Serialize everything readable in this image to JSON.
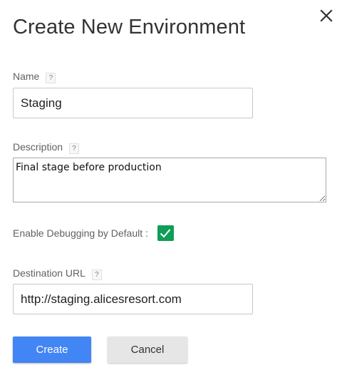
{
  "dialog": {
    "title": "Create New Environment"
  },
  "help_symbol": "?",
  "fields": {
    "name": {
      "label": "Name",
      "value": "Staging"
    },
    "description": {
      "label": "Description",
      "value": "Final stage before production"
    },
    "debugging": {
      "label": "Enable Debugging by Default :",
      "checked": true
    },
    "destination_url": {
      "label": "Destination URL",
      "value": "http://staging.alicesresort.com"
    }
  },
  "buttons": {
    "create_label": "Create",
    "cancel_label": "Cancel"
  },
  "icons": {
    "close": "close-icon",
    "help": "help-icon",
    "check": "check-icon"
  },
  "colors": {
    "primary": "#4285f4",
    "checkbox": "#0f9d58",
    "secondary_button": "#e6e6e6"
  }
}
